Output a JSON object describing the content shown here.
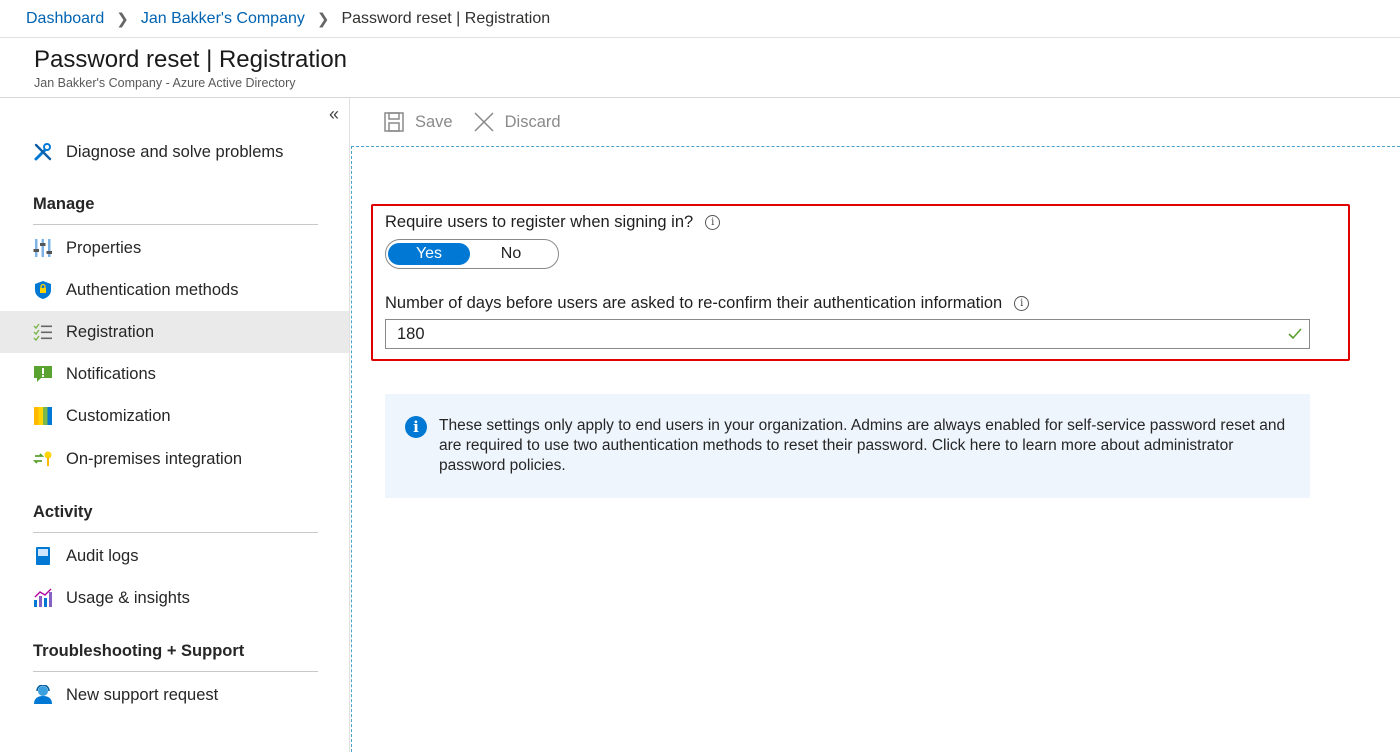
{
  "breadcrumb": {
    "items": [
      {
        "label": "Dashboard"
      },
      {
        "label": "Jan Bakker's Company"
      },
      {
        "label": "Password reset | Registration"
      }
    ]
  },
  "header": {
    "title": "Password reset | Registration",
    "subtitle": "Jan Bakker's Company - Azure Active Directory"
  },
  "sidebar": {
    "diagnose": "Diagnose and solve problems",
    "sections": {
      "manage": "Manage",
      "activity": "Activity",
      "support": "Troubleshooting + Support"
    },
    "manage_items": {
      "properties": "Properties",
      "auth_methods": "Authentication methods",
      "registration": "Registration",
      "notifications": "Notifications",
      "customization": "Customization",
      "onprem": "On-premises integration"
    },
    "activity_items": {
      "audit": "Audit logs",
      "usage": "Usage & insights"
    },
    "support_items": {
      "new_request": "New support request"
    },
    "selected": "Registration"
  },
  "toolbar": {
    "save_label": "Save",
    "discard_label": "Discard"
  },
  "form": {
    "require_label": "Require users to register when signing in?",
    "toggle": {
      "yes": "Yes",
      "no": "No",
      "selected": "Yes"
    },
    "days_label": "Number of days before users are asked to re-confirm their authentication information",
    "days_value": "180"
  },
  "info": {
    "text": "These settings only apply to end users in your organization. Admins are always enabled for self-service password reset and are required to use two authentication methods to reset their password. Click here to learn more about administrator password policies."
  },
  "colors": {
    "accent": "#0078d4",
    "link": "#0063b1",
    "highlight": "#e00000",
    "valid": "#5a9e2f"
  }
}
